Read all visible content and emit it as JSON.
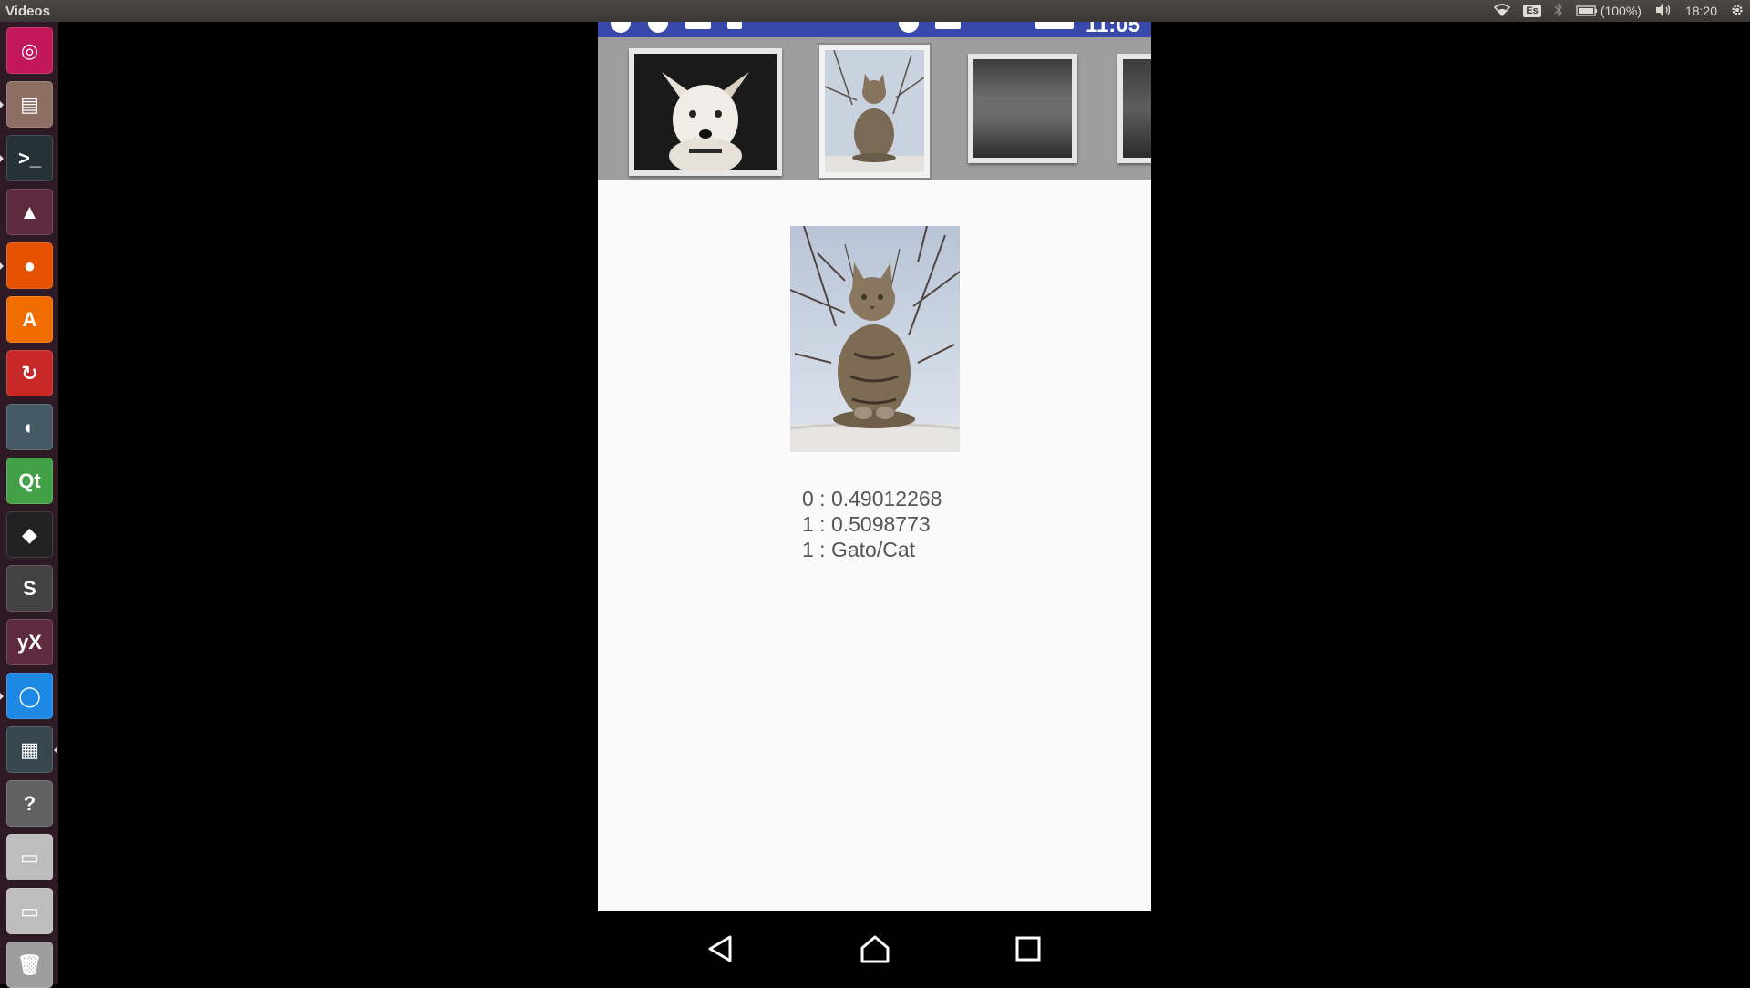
{
  "top_panel": {
    "app_title": "Videos",
    "keyboard_layout": "Es",
    "battery": "(100%)",
    "clock": "18:20",
    "icons": [
      "wifi-icon",
      "bluetooth-icon",
      "battery-icon",
      "volume-icon",
      "gear-icon"
    ]
  },
  "launcher": {
    "items": [
      {
        "name": "ubuntu-dash-icon",
        "color": "#c2185b",
        "glyph": "◎"
      },
      {
        "name": "files-icon",
        "color": "#8d6e63",
        "glyph": "▤"
      },
      {
        "name": "terminal-icon",
        "color": "#263238",
        "glyph": ">_"
      },
      {
        "name": "vlc-icon",
        "color": "#5d2b3d",
        "glyph": "▲"
      },
      {
        "name": "firefox-icon",
        "color": "#e65100",
        "glyph": "●"
      },
      {
        "name": "software-center-icon",
        "color": "#ef6c00",
        "glyph": "A"
      },
      {
        "name": "update-manager-icon",
        "color": "#c62828",
        "glyph": "↻"
      },
      {
        "name": "disk-usage-icon",
        "color": "#455a64",
        "glyph": "◐"
      },
      {
        "name": "qt-creator-icon",
        "color": "#43a047",
        "glyph": "Qt"
      },
      {
        "name": "inkscape-icon",
        "color": "#212121",
        "glyph": "◆"
      },
      {
        "name": "sublime-text-icon",
        "color": "#424242",
        "glyph": "S"
      },
      {
        "name": "yed-icon",
        "color": "#5d2b3d",
        "glyph": "yX"
      },
      {
        "name": "chromium-icon",
        "color": "#1e88e5",
        "glyph": "◯"
      },
      {
        "name": "video-editor-icon",
        "color": "#37474f",
        "glyph": "▦"
      },
      {
        "name": "help-icon",
        "color": "#616161",
        "glyph": "?"
      },
      {
        "name": "drive-icon",
        "color": "#bdbdbd",
        "glyph": "▭"
      },
      {
        "name": "drive-icon",
        "color": "#bdbdbd",
        "glyph": "▭"
      },
      {
        "name": "trash-icon",
        "color": "#9e9e9e",
        "glyph": "🗑"
      }
    ]
  },
  "phone": {
    "status_time": "11:05",
    "results": {
      "line1": "0 : 0.49012268",
      "line2": "1 : 0.5098773",
      "line3": "1 : Gato/Cat"
    },
    "nav": [
      "back-icon",
      "home-icon",
      "recents-icon"
    ]
  }
}
